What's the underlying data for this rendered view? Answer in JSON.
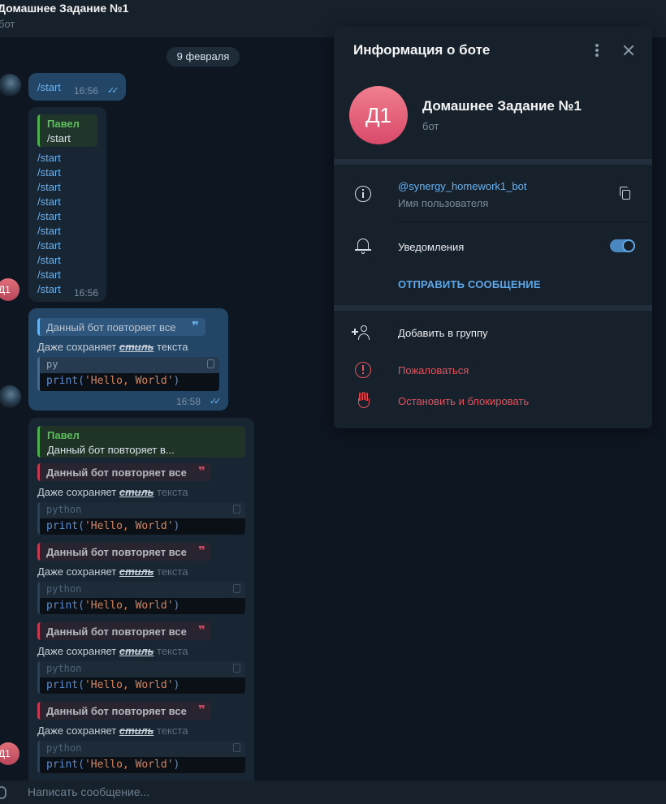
{
  "chat": {
    "title": "Домашнее Задание №1",
    "subtitle": "бот",
    "date": "9 февраля",
    "bot_avatar_initials": "Д1"
  },
  "messages": {
    "m1": {
      "text": "/start",
      "time": "16:56",
      "ticks": "✓✓"
    },
    "m2": {
      "reply_name": "Павел",
      "reply_text": "/start",
      "lines": [
        "/start",
        "/start",
        "/start",
        "/start",
        "/start",
        "/start",
        "/start",
        "/start",
        "/start",
        "/start"
      ],
      "time": "16:56"
    },
    "m3": {
      "quote": "Данный бот повторяет все",
      "quote_mark": "❞",
      "text_a": "Даже сохраняет ",
      "text_b": "стиль",
      "text_c": " текста",
      "code_lang": "py",
      "code_fn": "print(",
      "code_str": "'Hello, World'",
      "code_end": ")",
      "time": "16:58",
      "ticks": "✓✓"
    },
    "m4": {
      "reply_name": "Павел",
      "reply_text": "Данный бот повторяет в...",
      "quote": "Данный бот повторяет все",
      "quote_mark": "❞",
      "text_a": "Даже сохраняет ",
      "text_b": "стиль",
      "text_c": " текста",
      "code_lang": "python",
      "code_fn": "print(",
      "code_str": "'Hello, World'",
      "code_end": ")"
    }
  },
  "composer": {
    "placeholder": "Написать сообщение..."
  },
  "panel": {
    "title": "Информация о боте",
    "avatar_initials": "Д1",
    "bot_name": "Домашнее Задание №1",
    "bot_sub": "бот",
    "username": "@synergy_homework1_bot",
    "username_label": "Имя пользователя",
    "notifications_label": "Уведомления",
    "notifications_on": true,
    "send_message": "ОТПРАВИТЬ СООБЩЕНИЕ",
    "add_to_group": "Добавить в группу",
    "report": "Пожаловаться",
    "stop_block": "Остановить и блокировать"
  },
  "colors": {
    "background": "#0e1621",
    "panel": "#17212b",
    "accent": "#6ab3f3",
    "danger": "#e2535e",
    "reply_green": "#5fbf5f",
    "avatar_pink": "#e0707a"
  },
  "icons": [
    "attach-icon",
    "more-icon",
    "close-icon",
    "info-icon",
    "copy-icon",
    "bell-icon",
    "add-user-icon",
    "report-icon",
    "hand-icon",
    "quote-icon"
  ]
}
